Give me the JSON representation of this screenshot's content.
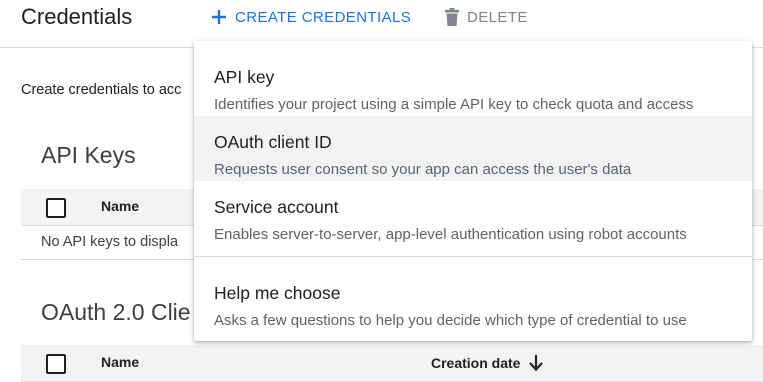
{
  "header": {
    "title": "Credentials",
    "create_label": "CREATE CREDENTIALS",
    "delete_label": "DELETE",
    "accent_color": "#1a73e8"
  },
  "intro_text": "Create credentials to acc",
  "api_keys": {
    "title": "API Keys",
    "columns": [
      "Name"
    ],
    "empty_text": "No API keys to displa"
  },
  "oauth": {
    "title": "OAuth 2.0 Clie",
    "columns": [
      "Name",
      "Creation date"
    ]
  },
  "menu": {
    "items": [
      {
        "title": "API key",
        "description": "Identifies your project using a simple API key to check quota and access"
      },
      {
        "title": "OAuth client ID",
        "description": "Requests user consent so your app can access the user's data"
      },
      {
        "title": "Service account",
        "description": "Enables server-to-server, app-level authentication using robot accounts"
      },
      {
        "title": "Help me choose",
        "description": "Asks a few questions to help you decide which type of credential to use"
      }
    ]
  },
  "icons": {
    "create": "add-icon",
    "delete": "trash-icon",
    "sort": "arrow-down-icon"
  }
}
